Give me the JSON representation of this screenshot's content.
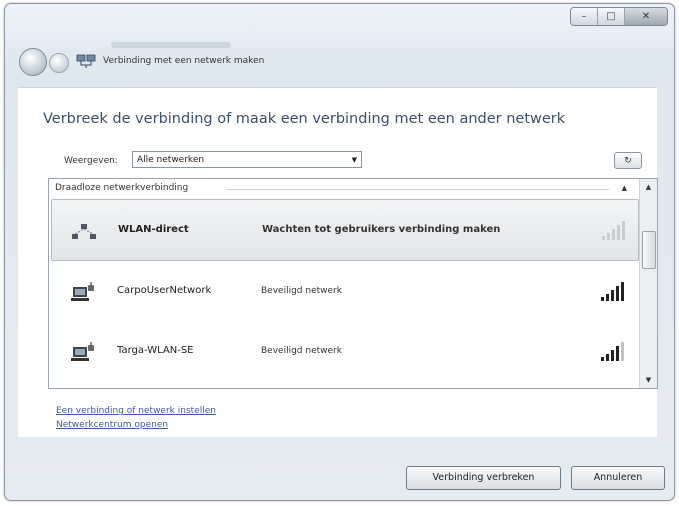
{
  "window": {
    "breadcrumb": "Verbinding met een netwerk maken",
    "minimize_glyph": "–",
    "maximize_glyph": "□",
    "close_glyph": "✕"
  },
  "main": {
    "heading": "Verbreek de verbinding of maak een verbinding met een ander netwerk",
    "show_label": "Weergeven:",
    "show_select_value": "Alle netwerken",
    "refresh_glyph": "↻",
    "group_header": "Draadloze netwerkverbinding",
    "networks": [
      {
        "name": "WLAN-direct",
        "status": "Wachten tot gebruikers verbinding maken",
        "signal_bars": 5,
        "selected": true,
        "icon": "adhoc-network-icon"
      },
      {
        "name": "CarpoUserNetwork",
        "status": "Beveiligd netwerk",
        "signal_bars": 5,
        "selected": false,
        "icon": "secured-network-icon"
      },
      {
        "name": "Targa-WLAN-SE",
        "status": "Beveiligd netwerk",
        "signal_bars": 4,
        "selected": false,
        "icon": "secured-network-icon"
      }
    ],
    "links": {
      "setup": "Een verbinding of netwerk instellen",
      "network_center": "Netwerkcentrum openen"
    }
  },
  "footer": {
    "disconnect_label": "Verbinding verbreken",
    "cancel_label": "Annuleren"
  },
  "colors": {
    "heading": "#3d4e70",
    "link": "#3b5ba8"
  }
}
